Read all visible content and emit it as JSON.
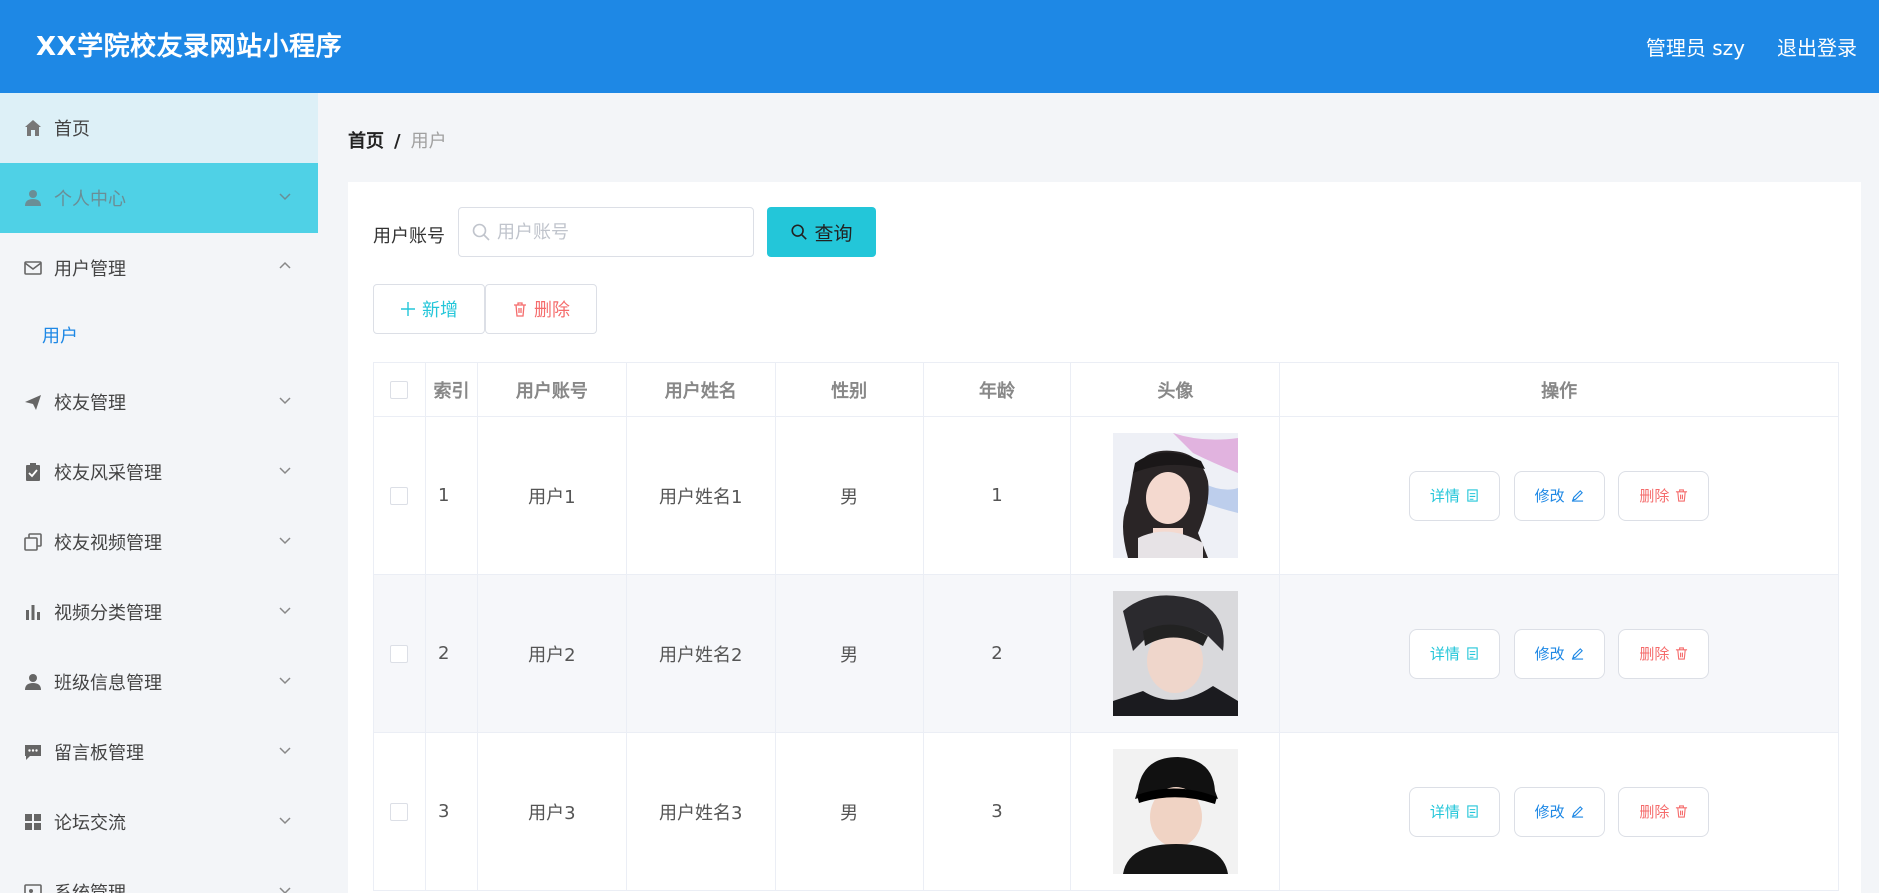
{
  "header": {
    "title": "XX学院校友录网站小程序",
    "admin_label": "管理员 szy",
    "logout_label": "退出登录",
    "bg_color": "#1e88e5"
  },
  "sidebar": {
    "items": [
      {
        "label": "首页",
        "icon": "home-icon"
      },
      {
        "label": "个人中心",
        "icon": "user-icon"
      },
      {
        "label": "用户管理",
        "icon": "mail-icon",
        "expanded": true,
        "sub": [
          "用户"
        ]
      },
      {
        "label": "校友管理",
        "icon": "send-icon"
      },
      {
        "label": "校友风采管理",
        "icon": "clipboard-icon"
      },
      {
        "label": "校友视频管理",
        "icon": "copy-icon"
      },
      {
        "label": "视频分类管理",
        "icon": "bar-chart-icon"
      },
      {
        "label": "班级信息管理",
        "icon": "person-icon"
      },
      {
        "label": "留言板管理",
        "icon": "message-icon"
      },
      {
        "label": "论坛交流",
        "icon": "grid-icon"
      },
      {
        "label": "系统管理",
        "icon": "settings-icon"
      }
    ],
    "active_color": "#4fd1e6"
  },
  "breadcrumb": {
    "home": "首页",
    "separator": "/",
    "current": "用户"
  },
  "search": {
    "label": "用户账号",
    "placeholder": "用户账号",
    "value": "",
    "button_label": "查询",
    "button_color": "#23c6d9"
  },
  "actions": {
    "add_label": "新增",
    "delete_label": "删除"
  },
  "table": {
    "columns": [
      "索引",
      "用户账号",
      "用户姓名",
      "性别",
      "年龄",
      "头像",
      "操作"
    ],
    "rows": [
      {
        "index": "1",
        "account": "用户1",
        "name": "用户姓名1",
        "gender": "男",
        "age": "1"
      },
      {
        "index": "2",
        "account": "用户2",
        "name": "用户姓名2",
        "gender": "男",
        "age": "2"
      },
      {
        "index": "3",
        "account": "用户3",
        "name": "用户姓名3",
        "gender": "男",
        "age": "3"
      }
    ],
    "row_actions": {
      "detail_label": "详情",
      "edit_label": "修改",
      "delete_label": "删除"
    }
  }
}
